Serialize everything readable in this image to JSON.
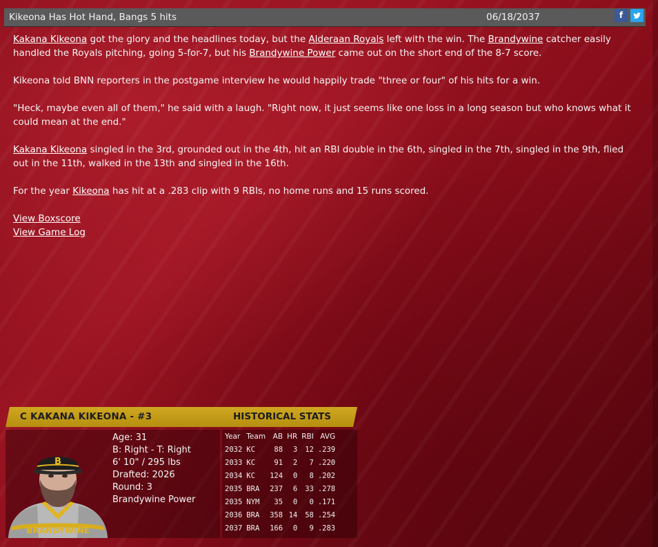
{
  "header": {
    "title": "Kikeona Has Hot Hand, Bangs 5 hits",
    "date": "06/18/2037",
    "facebook_glyph": "f",
    "twitter_glyph": "🐦"
  },
  "article": {
    "p1": {
      "link1": "Kakana Kikeona",
      "t1": " got the glory and the headlines today, but the ",
      "link2": "Alderaan Royals",
      "t2": " left with the win. The ",
      "link3": "Brandywine",
      "t3": " catcher easily handled the Royals pitching, going 5-for-7, but his ",
      "link4": "Brandywine Power",
      "t4": " came out on the short end of the 8-7 score."
    },
    "p2": "Kikeona told BNN reporters in the postgame interview he would happily trade \"three or four\" of his hits for a win.",
    "p3": "\"Heck, maybe even all of them,\" he said with a laugh. \"Right now, it just seems like one loss in a long season but who knows what it could mean at the end.\"",
    "p4": {
      "link": "Kakana Kikeona",
      "text": " singled in the 3rd, grounded out in the 4th, hit an RBI double in the 6th, singled in the 7th, singled in the 9th, flied out in the 11th, walked in the 13th and singled in the 16th."
    },
    "p5": {
      "t1": "For the year ",
      "link": "Kikeona",
      "t2": " has hit at a .283 clip with 9 RBIs, no home runs and 15 runs scored."
    },
    "view_boxscore": "View Boxscore",
    "view_game_log": "View Game Log"
  },
  "player_card": {
    "name": "C KAKANA KIKEONA - #3",
    "historical_label": "HISTORICAL STATS",
    "age": "Age: 31",
    "bats_throws": "B: Right - T: Right",
    "size": "6' 10\" / 295 lbs",
    "drafted": "Drafted: 2026",
    "round": "Round: 3",
    "team": "Brandywine Power",
    "cap_letter": "B",
    "jersey_text": "BRANDYWINE",
    "stats": {
      "headers": [
        "Year",
        "Team",
        "AB",
        "HR",
        "RBI",
        "AVG"
      ],
      "rows": [
        [
          "2032",
          "KC",
          "88",
          "3",
          "12",
          ".239"
        ],
        [
          "2033",
          "KC",
          "91",
          "2",
          "7",
          ".220"
        ],
        [
          "2034",
          "KC",
          "124",
          "0",
          "8",
          ".202"
        ],
        [
          "2035",
          "BRA",
          "237",
          "6",
          "33",
          ".278"
        ],
        [
          "2035",
          "NYM",
          "35",
          "0",
          "0",
          ".171"
        ],
        [
          "2036",
          "BRA",
          "358",
          "14",
          "58",
          ".254"
        ],
        [
          "2037",
          "BRA",
          "166",
          "0",
          "9",
          ".283"
        ]
      ]
    }
  },
  "colors": {
    "background_red": "#8f1020",
    "header_gold": "#c49b18",
    "title_bar_gray": "#5a5a5a",
    "facebook_blue": "#3b5998",
    "twitter_blue": "#2aa3ef"
  }
}
